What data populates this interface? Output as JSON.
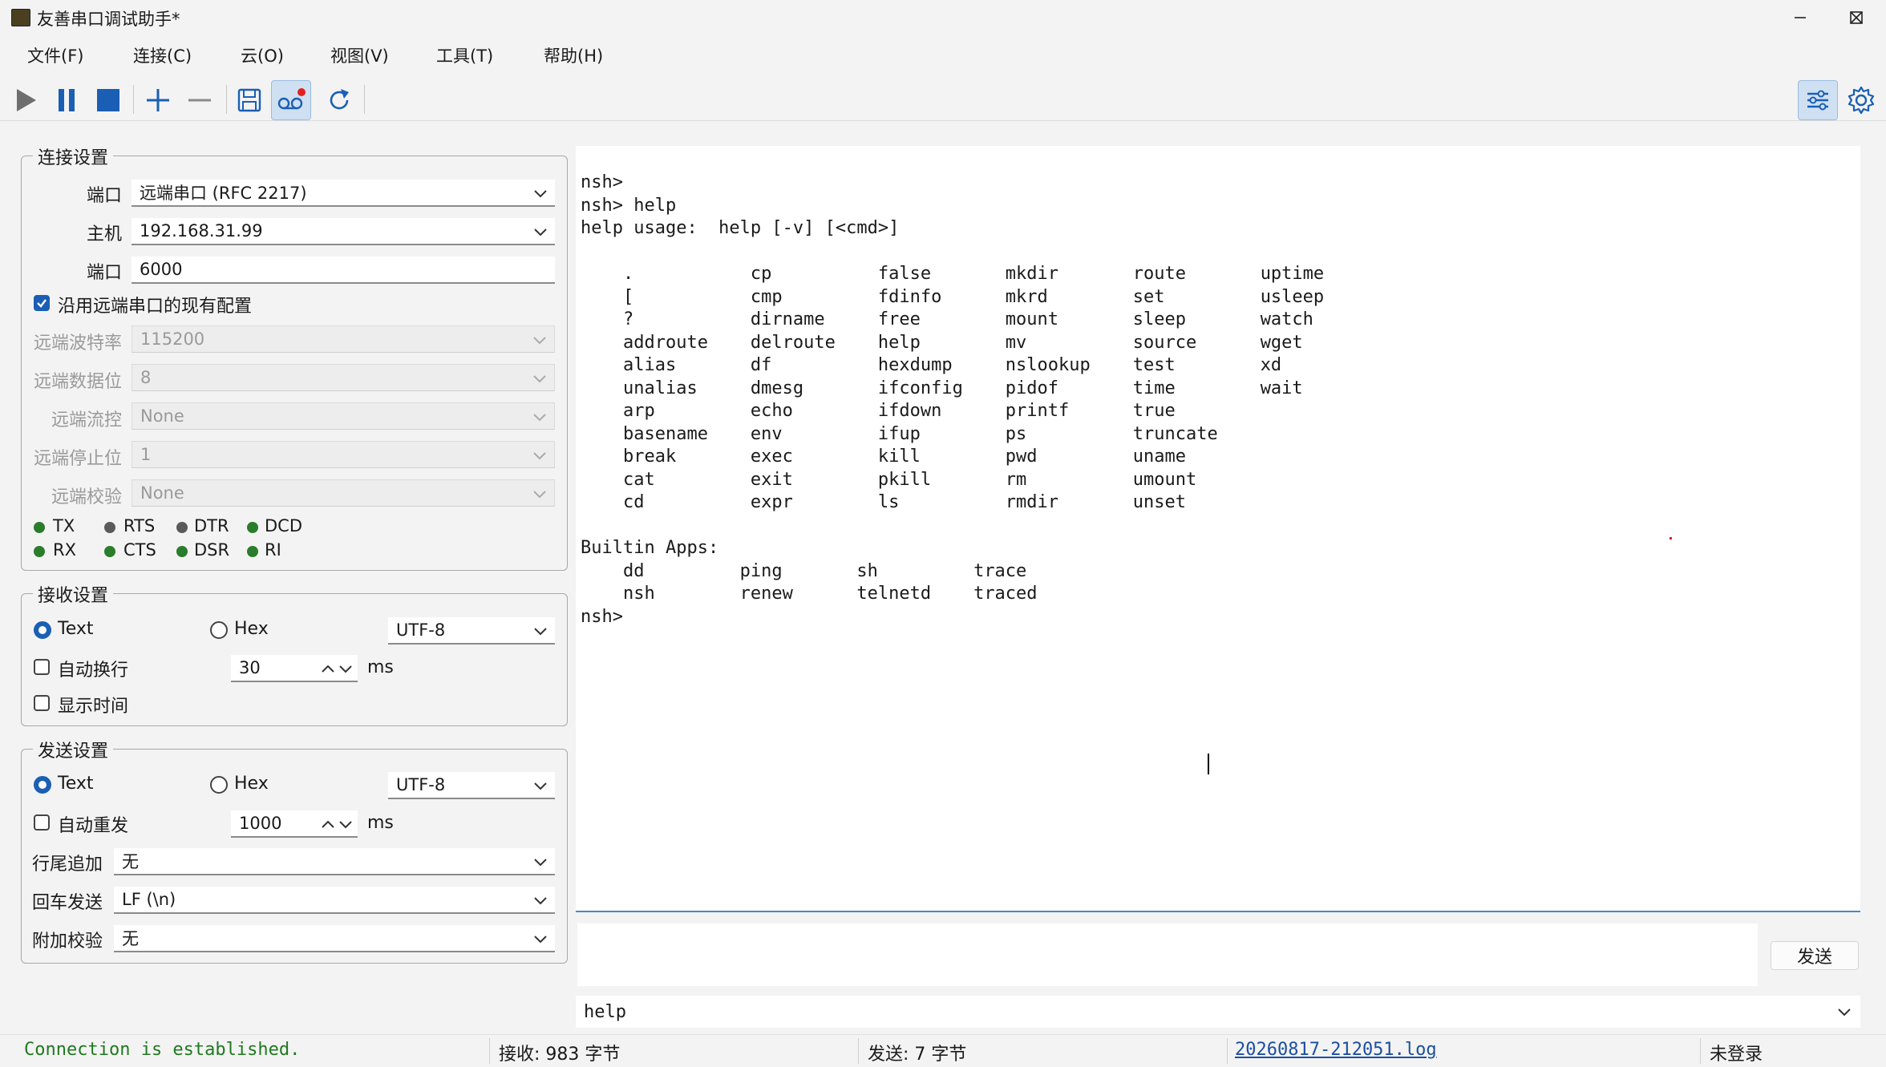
{
  "window": {
    "title": "友善串口调试助手*"
  },
  "menu": [
    "文件(F)",
    "连接(C)",
    "云(O)",
    "视图(V)",
    "工具(T)",
    "帮助(H)"
  ],
  "toolbar": {
    "icons": [
      "play-icon",
      "pause-icon",
      "stop-icon",
      "plus-icon",
      "minus-icon",
      "save-icon",
      "record-icon",
      "refresh-icon",
      "settings-sliders-icon",
      "gear-icon"
    ],
    "accent": "#1a5fb4"
  },
  "connection": {
    "title": "连接设置",
    "port_label": "端口",
    "port_value": "远端串口 (RFC 2217)",
    "host_label": "主机",
    "host_value": "192.168.31.99",
    "tcp_port_label": "端口",
    "tcp_port_value": "6000",
    "use_remote_label": "沿用远端串口的现有配置",
    "use_remote_checked": true,
    "remote": [
      {
        "label": "远端波特率",
        "value": "115200"
      },
      {
        "label": "远端数据位",
        "value": "8"
      },
      {
        "label": "远端流控",
        "value": "None"
      },
      {
        "label": "远端停止位",
        "value": "1"
      },
      {
        "label": "远端校验",
        "value": "None"
      }
    ],
    "signals_row1": [
      "TX",
      "RTS",
      "DTR",
      "DCD"
    ],
    "signals_row2": [
      "RX",
      "CTS",
      "DSR",
      "RI"
    ]
  },
  "receive": {
    "title": "接收设置",
    "text_label": "Text",
    "hex_label": "Hex",
    "encoding": "UTF-8",
    "auto_wrap_label": "自动换行",
    "wrap_ms": "30",
    "ms_unit": "ms",
    "show_time_label": "显示时间"
  },
  "send": {
    "title": "发送设置",
    "text_label": "Text",
    "hex_label": "Hex",
    "encoding": "UTF-8",
    "auto_resend_label": "自动重发",
    "resend_ms": "1000",
    "ms_unit": "ms",
    "line_end_label": "行尾追加",
    "line_end_value": "无",
    "enter_label": "回车发送",
    "enter_value": "LF (\\n)",
    "checksum_label": "附加校验",
    "checksum_value": "无",
    "send_button": "发送",
    "history_value": "help"
  },
  "terminal": {
    "output": "nsh>\nnsh> help\nhelp usage:  help [-v] [<cmd>]\n\n    .           cp          false       mkdir       route       uptime\n    [           cmp         fdinfo      mkrd        set         usleep\n    ?           dirname     free        mount       sleep       watch\n    addroute    delroute    help        mv          source      wget\n    alias       df          hexdump     nslookup    test        xd\n    unalias     dmesg       ifconfig    pidof       time        wait\n    arp         echo        ifdown      printf      true\n    basename    env         ifup        ps          truncate\n    break       exec        kill        pwd         uname\n    cat         exit        pkill       rm          umount\n    cd          expr        ls          rmdir       unset\n\nBuiltin Apps:\n    dd         ping       sh         trace\n    nsh        renew      telnetd    traced\nnsh> "
  },
  "status": {
    "connection": "Connection is established.",
    "received": "接收: 983 字节",
    "sent": "发送: 7 字节",
    "log_file": "20260817-212051.log",
    "login": "未登录",
    "connection_color": "#1f7a1f",
    "link_color": "#1a4fa0"
  }
}
